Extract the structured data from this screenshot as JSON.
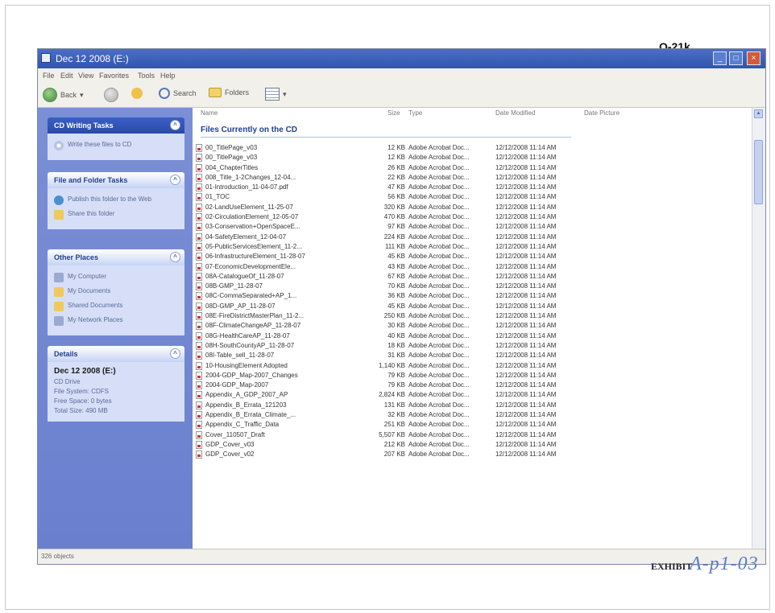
{
  "stamp": "O-21k",
  "exhibit": {
    "label": "EXHIBIT",
    "hand": "A-p1-03"
  },
  "window": {
    "title": "Dec 12 2008 (E:)"
  },
  "menu": [
    "File",
    "Edit",
    "View",
    "Favorites",
    "Tools",
    "Help"
  ],
  "toolbar": {
    "back": "Back",
    "search": "Search",
    "folders": "Folders"
  },
  "taskpane": {
    "cd_tasks": {
      "title": "CD Writing Tasks",
      "items": [
        "Write these files to CD"
      ]
    },
    "file_tasks": {
      "title": "File and Folder Tasks",
      "items": [
        "Publish this folder to the Web",
        "Share this folder"
      ]
    },
    "other_places": {
      "title": "Other Places",
      "items": [
        "My Computer",
        "My Documents",
        "Shared Documents",
        "My Network Places"
      ]
    },
    "details": {
      "title": "Details",
      "name": "Dec 12 2008 (E:)",
      "type": "CD Drive",
      "lines": [
        "File System: CDFS",
        "Free Space: 0 bytes",
        "Total Size: 490 MB"
      ]
    }
  },
  "columns": {
    "name": "Name",
    "size": "Size",
    "type": "Type",
    "date": "Date Modified",
    "date_picture": "Date Picture"
  },
  "group_title": "Files Currently on the CD",
  "files": [
    {
      "name": "00_TitlePage_v03",
      "size": "12 KB",
      "type": "Adobe Acrobat Doc...",
      "date": "12/12/2008 11:14 AM"
    },
    {
      "name": "00_TitlePage_v03",
      "size": "12 KB",
      "type": "Adobe Acrobat Doc...",
      "date": "12/12/2008 11:14 AM"
    },
    {
      "name": "004_ChapterTitles",
      "size": "26 KB",
      "type": "Adobe Acrobat Doc...",
      "date": "12/12/2008 11:14 AM"
    },
    {
      "name": "008_Title_1-2Changes_12-04...",
      "size": "22 KB",
      "type": "Adobe Acrobat Doc...",
      "date": "12/12/2008 11:14 AM"
    },
    {
      "name": "01-Introduction_11-04-07.pdf",
      "size": "47 KB",
      "type": "Adobe Acrobat Doc...",
      "date": "12/12/2008 11:14 AM"
    },
    {
      "name": "01_TOC",
      "size": "56 KB",
      "type": "Adobe Acrobat Doc...",
      "date": "12/12/2008 11:14 AM"
    },
    {
      "name": "02-LandUseElement_11-25-07",
      "size": "320 KB",
      "type": "Adobe Acrobat Doc...",
      "date": "12/12/2008 11:14 AM"
    },
    {
      "name": "02-CirculationElement_12-05-07",
      "size": "470 KB",
      "type": "Adobe Acrobat Doc...",
      "date": "12/12/2008 11:14 AM"
    },
    {
      "name": "03-Conservation+OpenSpaceE...",
      "size": "97 KB",
      "type": "Adobe Acrobat Doc...",
      "date": "12/12/2008 11:14 AM"
    },
    {
      "name": "04-SafetyElement_12-04-07",
      "size": "224 KB",
      "type": "Adobe Acrobat Doc...",
      "date": "12/12/2008 11:14 AM"
    },
    {
      "name": "05-PublicServicesElement_11-2...",
      "size": "111 KB",
      "type": "Adobe Acrobat Doc...",
      "date": "12/12/2008 11:14 AM"
    },
    {
      "name": "06-InfrastructureElement_11-28-07",
      "size": "45 KB",
      "type": "Adobe Acrobat Doc...",
      "date": "12/12/2008 11:14 AM"
    },
    {
      "name": "07-EconomicDevelopmentEle...",
      "size": "43 KB",
      "type": "Adobe Acrobat Doc...",
      "date": "12/12/2008 11:14 AM"
    },
    {
      "name": "08A-CatalogueOf_11-28-07",
      "size": "67 KB",
      "type": "Adobe Acrobat Doc...",
      "date": "12/12/2008 11:14 AM"
    },
    {
      "name": "08B-GMP_11-28-07",
      "size": "70 KB",
      "type": "Adobe Acrobat Doc...",
      "date": "12/12/2008 11:14 AM"
    },
    {
      "name": "08C-CommaSeparated+AP_1...",
      "size": "36 KB",
      "type": "Adobe Acrobat Doc...",
      "date": "12/12/2008 11:14 AM"
    },
    {
      "name": "08D-GMP_AP_11-28-07",
      "size": "45 KB",
      "type": "Adobe Acrobat Doc...",
      "date": "12/12/2008 11:14 AM"
    },
    {
      "name": "08E-FireDistrictMasterPlan_11-2...",
      "size": "250 KB",
      "type": "Adobe Acrobat Doc...",
      "date": "12/12/2008 11:14 AM"
    },
    {
      "name": "08F-ClimateChangeAP_11-28-07",
      "size": "30 KB",
      "type": "Adobe Acrobat Doc...",
      "date": "12/12/2008 11:14 AM"
    },
    {
      "name": "08G-HealthCareAP_11-28-07",
      "size": "40 KB",
      "type": "Adobe Acrobat Doc...",
      "date": "12/12/2008 11:14 AM"
    },
    {
      "name": "08H-SouthCountyAP_11-28-07",
      "size": "18 KB",
      "type": "Adobe Acrobat Doc...",
      "date": "12/12/2008 11:14 AM"
    },
    {
      "name": "08I-Table_sell_11-28-07",
      "size": "31 KB",
      "type": "Adobe Acrobat Doc...",
      "date": "12/12/2008 11:14 AM"
    },
    {
      "name": "10-HousingElement Adopted",
      "size": "1,140 KB",
      "type": "Adobe Acrobat Doc...",
      "date": "12/12/2008 11:14 AM"
    },
    {
      "name": "2004-GDP_Map-2007_Changes",
      "size": "79 KB",
      "type": "Adobe Acrobat Doc...",
      "date": "12/12/2008 11:14 AM"
    },
    {
      "name": "2004-GDP_Map-2007",
      "size": "79 KB",
      "type": "Adobe Acrobat Doc...",
      "date": "12/12/2008 11:14 AM"
    },
    {
      "name": "Appendix_A_GDP_2007_AP",
      "size": "2,824 KB",
      "type": "Adobe Acrobat Doc...",
      "date": "12/12/2008 11:14 AM"
    },
    {
      "name": "Appendix_B_Errata_121203",
      "size": "131 KB",
      "type": "Adobe Acrobat Doc...",
      "date": "12/12/2008 11:14 AM"
    },
    {
      "name": "Appendix_B_Errata_Climate_...",
      "size": "32 KB",
      "type": "Adobe Acrobat Doc...",
      "date": "12/12/2008 11:14 AM"
    },
    {
      "name": "Appendix_C_Traffic_Data",
      "size": "251 KB",
      "type": "Adobe Acrobat Doc...",
      "date": "12/12/2008 11:14 AM"
    },
    {
      "name": "Cover_110507_Draft",
      "size": "5,507 KB",
      "type": "Adobe Acrobat Doc...",
      "date": "12/12/2008 11:14 AM"
    },
    {
      "name": "GDP_Cover_v03",
      "size": "212 KB",
      "type": "Adobe Acrobat Doc...",
      "date": "12/12/2008 11:14 AM"
    },
    {
      "name": "GDP_Cover_v02",
      "size": "207 KB",
      "type": "Adobe Acrobat Doc...",
      "date": "12/12/2008 11:14 AM"
    }
  ],
  "status": "326 objects"
}
